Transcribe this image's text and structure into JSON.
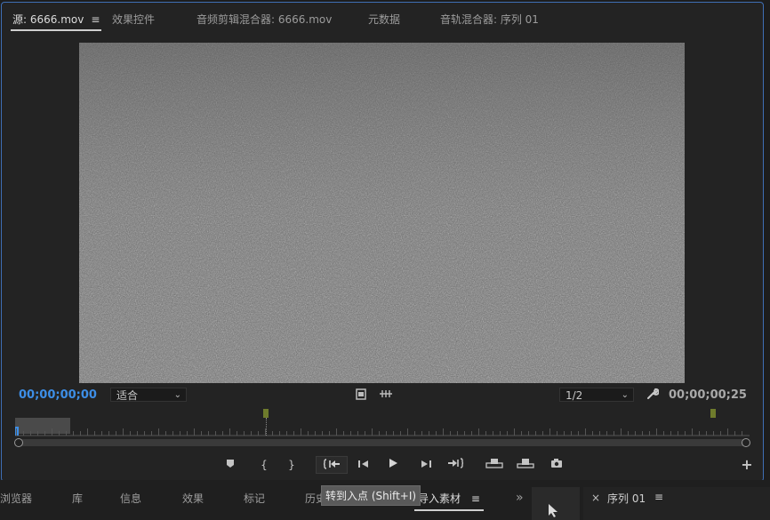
{
  "source_panel": {
    "tabs": [
      {
        "label": "源: 6666.mov",
        "active": true
      },
      {
        "label": "效果控件"
      },
      {
        "label": "音频剪辑混合器: 6666.mov"
      },
      {
        "label": "元数据"
      },
      {
        "label": "音轨混合器: 序列 01"
      }
    ],
    "menu_icon": "hamburger-menu-icon",
    "timecode_current": "00;00;00;00",
    "zoom_select": "适合",
    "resolution_select": "1/2",
    "timecode_duration": "00;00;00;25",
    "icons": {
      "export_frame": "film-icon",
      "settings_wrench": "wrench-icon",
      "add_button": "plus-icon"
    }
  },
  "transport": {
    "buttons": [
      {
        "name": "add-marker-button",
        "glyph": "⬟"
      },
      {
        "name": "mark-in-button",
        "glyph": "{"
      },
      {
        "name": "mark-out-button",
        "glyph": "}"
      },
      {
        "name": "go-to-in-button",
        "glyph": "{⇤"
      },
      {
        "name": "step-back-button",
        "glyph": "◂|"
      },
      {
        "name": "play-button",
        "glyph": "▶"
      },
      {
        "name": "step-forward-button",
        "glyph": "|▸"
      },
      {
        "name": "go-to-out-button",
        "glyph": "⇥}"
      },
      {
        "name": "insert-button",
        "glyph": "⊞"
      },
      {
        "name": "overwrite-button",
        "glyph": "⊟"
      },
      {
        "name": "export-frame-button",
        "glyph": "📷"
      }
    ]
  },
  "tooltip": "转到入点 (Shift+I)",
  "lower_panel": {
    "tabs": [
      "浏览器",
      "库",
      "信息",
      "效果",
      "标记",
      "历史",
      "导入素材"
    ],
    "active_tab": "导入素材",
    "overflow": "»",
    "sequence_tab": "序列 01",
    "close": "×",
    "menu": "≡"
  }
}
